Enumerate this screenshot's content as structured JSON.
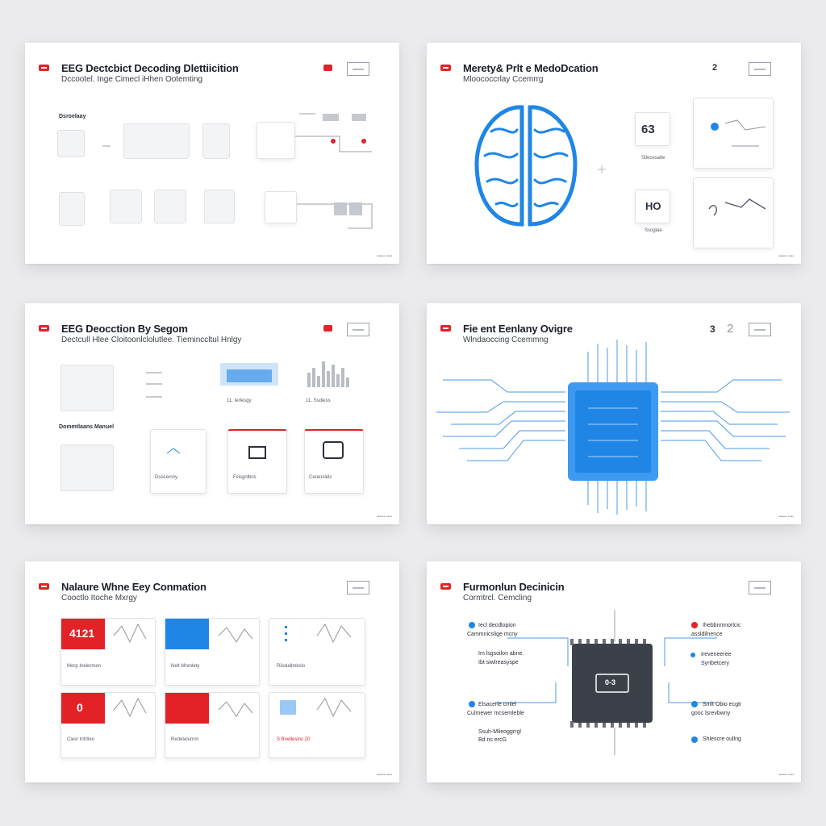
{
  "slides": [
    {
      "title": "EEG Dectcbict Decoding Dlettiicition",
      "subtitle": "Dccootel. Inge Cimecl iHhen Ootemting",
      "label_section": "Dsroelaay",
      "footer": "•••••• ••••"
    },
    {
      "title": "Merety& Prlt e MedoDcation",
      "subtitle": "Mloococcrlay Ccemrrg",
      "page_num": "2",
      "card_a": "63",
      "card_b": "HO",
      "cap_a": "Stlecesalte",
      "cap_b": "Ssoglae",
      "footer": "•••••• ••••"
    },
    {
      "title": "EEG Deocction By Segom",
      "subtitle": "Dectcull Hlee Cloitoonlclolutlee. Tieminccltul Hnlgy",
      "label_section": "Dommtlaans Manuel",
      "cap_a": "Dsoceinny",
      "cap_b": "Fslsgnlbns",
      "cap_c": "Cerenslels",
      "tick_a": "11. Ierlesgy",
      "tick_b": "11. Ssdiess",
      "footer": "•••••• ••••"
    },
    {
      "title": "Fie ent Eenlany Ovigre",
      "subtitle": "Wlndaoccing Ccemmng",
      "page_a": "3",
      "page_b": "2",
      "footer": "•••••• ••••"
    },
    {
      "title": "Nalaure Whne Eey Conmation",
      "subtitle": "Cooctlo Itoche Mxrgy",
      "tile_a": "4121",
      "tile_b": "0",
      "caps": [
        "Merp Inelermen",
        "Nelt Mrenlety",
        "Riisdallmkslo",
        "Clesr Intrtlen",
        "Redetelurnm",
        "S Bnellesinc 20"
      ],
      "footer": "•••••• ••••"
    },
    {
      "title": "Furmonlun Decinicin",
      "subtitle": "Cormtrcl. Cemcling",
      "chip_label": "0-3",
      "left_items": [
        "Iecl decdlopion",
        "Cammnicslige mcny",
        "Im lsgsoilon abne.",
        "Ibt siwlreasyspe",
        "Elsacerle cmlel",
        "Culmewer mcsemleble",
        "Ssuh-Mlieoggrrgl",
        "Bd ns ercG"
      ],
      "right_items": [
        "Ihebbnmnorlcic",
        "assldilnence",
        "Ireveneeree",
        "Syribetcery",
        "Smlt Obio ecgtr",
        "gooc lsrevbwny",
        "Shlescre oullng"
      ],
      "footer": "•••••• ••••"
    }
  ],
  "colors": {
    "accent_red": "#e32228",
    "accent_blue": "#1f86e6",
    "chip_dark": "#3c4049"
  }
}
